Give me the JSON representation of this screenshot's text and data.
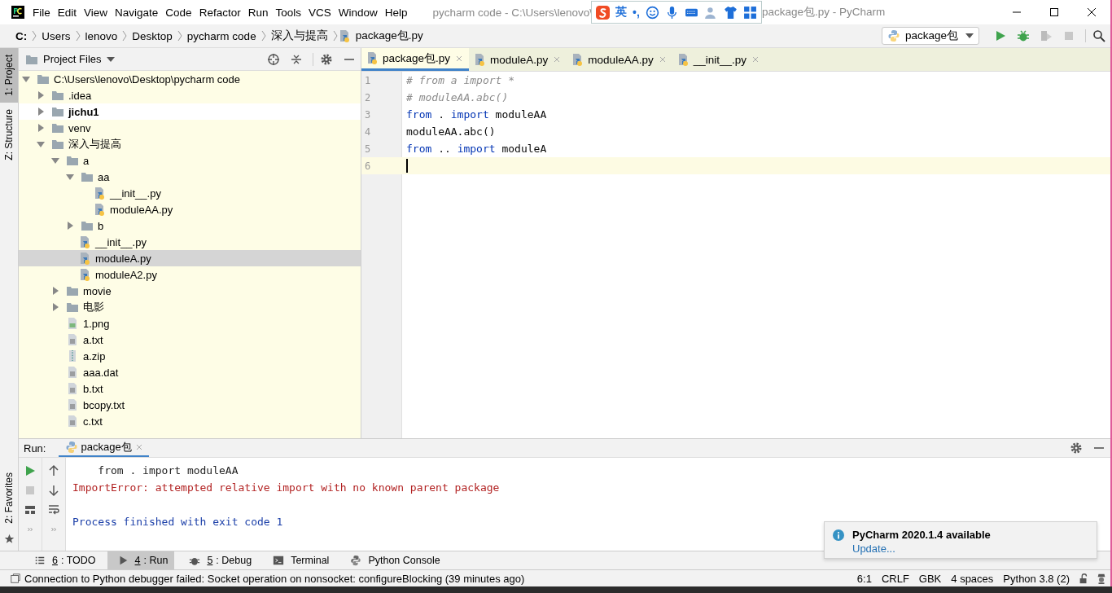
{
  "window": {
    "title_left": "pycharm code - C:\\Users\\lenovo\\",
    "title_right": "package包.py - PyCharm"
  },
  "ime": {
    "label": "英",
    "punct": "•,"
  },
  "menu": [
    "File",
    "Edit",
    "View",
    "Navigate",
    "Code",
    "Refactor",
    "Run",
    "Tools",
    "VCS",
    "Window",
    "Help"
  ],
  "breadcrumbs": [
    "C:",
    "Users",
    "lenovo",
    "Desktop",
    "pycharm code",
    "深入与提高",
    "package包.py"
  ],
  "run_config": "package包",
  "left_stripe": [
    {
      "label": "1: Project",
      "selected": true
    },
    {
      "label": "Z: Structure",
      "selected": false
    }
  ],
  "favorites_stripe": "2: Favorites",
  "project": {
    "title": "Project Files",
    "tree": [
      {
        "name": "C:\\Users\\lenovo\\Desktop\\pycharm code",
        "kind": "folder",
        "expanded": true,
        "selected": false,
        "children": [
          {
            "name": ".idea",
            "kind": "folder",
            "expanded": false,
            "selected": false
          },
          {
            "name": "jichu1",
            "kind": "root",
            "expanded": false,
            "selected": false
          },
          {
            "name": "venv",
            "kind": "folder",
            "expanded": false,
            "selected": false
          },
          {
            "name": "深入与提高",
            "kind": "folder",
            "expanded": true,
            "selected": false,
            "children": [
              {
                "name": "a",
                "kind": "folder",
                "expanded": true,
                "selected": false,
                "children": [
                  {
                    "name": "aa",
                    "kind": "folder",
                    "expanded": true,
                    "selected": false,
                    "children": [
                      {
                        "name": "__init__.py",
                        "kind": "py",
                        "selected": false
                      },
                      {
                        "name": "moduleAA.py",
                        "kind": "py",
                        "selected": false
                      }
                    ]
                  },
                  {
                    "name": "b",
                    "kind": "folder",
                    "expanded": false,
                    "selected": false
                  },
                  {
                    "name": "__init__.py",
                    "kind": "py",
                    "selected": false
                  },
                  {
                    "name": "moduleA.py",
                    "kind": "py",
                    "selected": true
                  },
                  {
                    "name": "moduleA2.py",
                    "kind": "py",
                    "selected": false
                  }
                ]
              },
              {
                "name": "movie",
                "kind": "folder",
                "expanded": false,
                "selected": false
              },
              {
                "name": "电影",
                "kind": "folder",
                "expanded": false,
                "selected": false
              },
              {
                "name": "1.png",
                "kind": "image",
                "selected": false
              },
              {
                "name": "a.txt",
                "kind": "text",
                "selected": false
              },
              {
                "name": "a.zip",
                "kind": "zip",
                "selected": false
              },
              {
                "name": "aaa.dat",
                "kind": "text",
                "selected": false
              },
              {
                "name": "b.txt",
                "kind": "text",
                "selected": false
              },
              {
                "name": "bcopy.txt",
                "kind": "text",
                "selected": false
              },
              {
                "name": "c.txt",
                "kind": "text",
                "selected": false
              }
            ]
          }
        ]
      }
    ]
  },
  "editor_tabs": [
    {
      "label": "package包.py",
      "selected": true
    },
    {
      "label": "moduleA.py",
      "selected": false
    },
    {
      "label": "moduleAA.py",
      "selected": false
    },
    {
      "label": "__init__.py",
      "selected": false
    }
  ],
  "code": [
    {
      "number": "1",
      "tokens": [
        {
          "t": "# from a import *",
          "kind": "comment"
        }
      ]
    },
    {
      "number": "2",
      "tokens": [
        {
          "t": "# moduleAA.abc()",
          "kind": "comment"
        }
      ]
    },
    {
      "number": "3",
      "tokens": [
        {
          "t": "from",
          "kind": "keyword"
        },
        {
          "t": " . ",
          "kind": "plain"
        },
        {
          "t": "import",
          "kind": "keyword"
        },
        {
          "t": " moduleAA",
          "kind": "plain"
        }
      ]
    },
    {
      "number": "4",
      "tokens": [
        {
          "t": "moduleAA.abc()",
          "kind": "plain"
        }
      ]
    },
    {
      "number": "5",
      "tokens": [
        {
          "t": "from",
          "kind": "keyword"
        },
        {
          "t": " .. ",
          "kind": "plain"
        },
        {
          "t": "import",
          "kind": "keyword"
        },
        {
          "t": " moduleA",
          "kind": "plain"
        }
      ]
    },
    {
      "number": "6",
      "current": true
    }
  ],
  "run": {
    "label": "Run:",
    "tab": "package包",
    "output": [
      {
        "t": "    from . import moduleAA",
        "kind": "plain"
      },
      {
        "t": "ImportError: attempted relative import with no known parent package",
        "kind": "error"
      },
      {
        "kind": "blank"
      },
      {
        "t": "Process finished with exit code 1",
        "kind": "system"
      }
    ]
  },
  "tool_tabs": [
    {
      "num": "6",
      "label": ": TODO",
      "selected": false
    },
    {
      "num": "4",
      "label": ": Run",
      "selected": true
    },
    {
      "num": "5",
      "label": ": Debug",
      "selected": false
    },
    {
      "label": "Terminal",
      "selected": false
    },
    {
      "label": "Python Console",
      "selected": false
    }
  ],
  "notification": {
    "title": "PyCharm 2020.1.4 available",
    "link": "Update..."
  },
  "status_bar": {
    "message": "Connection to Python debugger failed: Socket operation on nonsocket: configureBlocking (39 minutes ago)",
    "items": [
      "6:1",
      "CRLF",
      "GBK",
      "4 spaces",
      "Python 3.8 (2)"
    ]
  }
}
